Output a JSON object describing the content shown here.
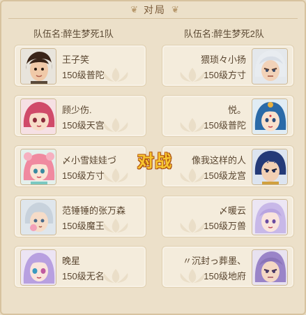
{
  "title": "对局",
  "vs_label": "对战",
  "team_left": {
    "name": "队伍名:醉生梦死1队",
    "players": [
      {
        "name": "王子笑",
        "info": "150级普陀",
        "avatar": "male-hair-avatar"
      },
      {
        "name": "顾少伤.",
        "info": "150级天宫",
        "avatar": "pink-hair-girl-avatar"
      },
      {
        "name": "〆小雪娃娃づ",
        "info": "150级方寸",
        "avatar": "pink-flower-girl-avatar"
      },
      {
        "name": "范锤锤的张万森",
        "info": "150级魔王",
        "avatar": "silver-hair-boy-avatar"
      },
      {
        "name": "晚星",
        "info": "150级无名",
        "avatar": "purple-hair-girl-avatar"
      }
    ]
  },
  "team_right": {
    "name": "队伍名:醉生梦死2队",
    "players": [
      {
        "name": "猥琐々小扬",
        "info": "150级方寸",
        "avatar": "white-hair-warrior-avatar"
      },
      {
        "name": "悦。",
        "info": "150级普陀",
        "avatar": "blue-hair-woman-avatar"
      },
      {
        "name": "像我这样的人",
        "info": "150级龙宫",
        "avatar": "dark-blue-hair-man-avatar"
      },
      {
        "name": "〆暖云",
        "info": "150级万兽",
        "avatar": "lavender-hair-woman-avatar"
      },
      {
        "name": "〃沉封っ葬墨、",
        "info": "150级地府",
        "avatar": "purple-hair-man-avatar"
      }
    ]
  },
  "colors": {
    "panel_bg": "#ece0c9",
    "card_bg": "#f4ecdc",
    "text": "#5a4630",
    "vs_fill": "#f7c530",
    "vs_outline": "#a0420a"
  }
}
